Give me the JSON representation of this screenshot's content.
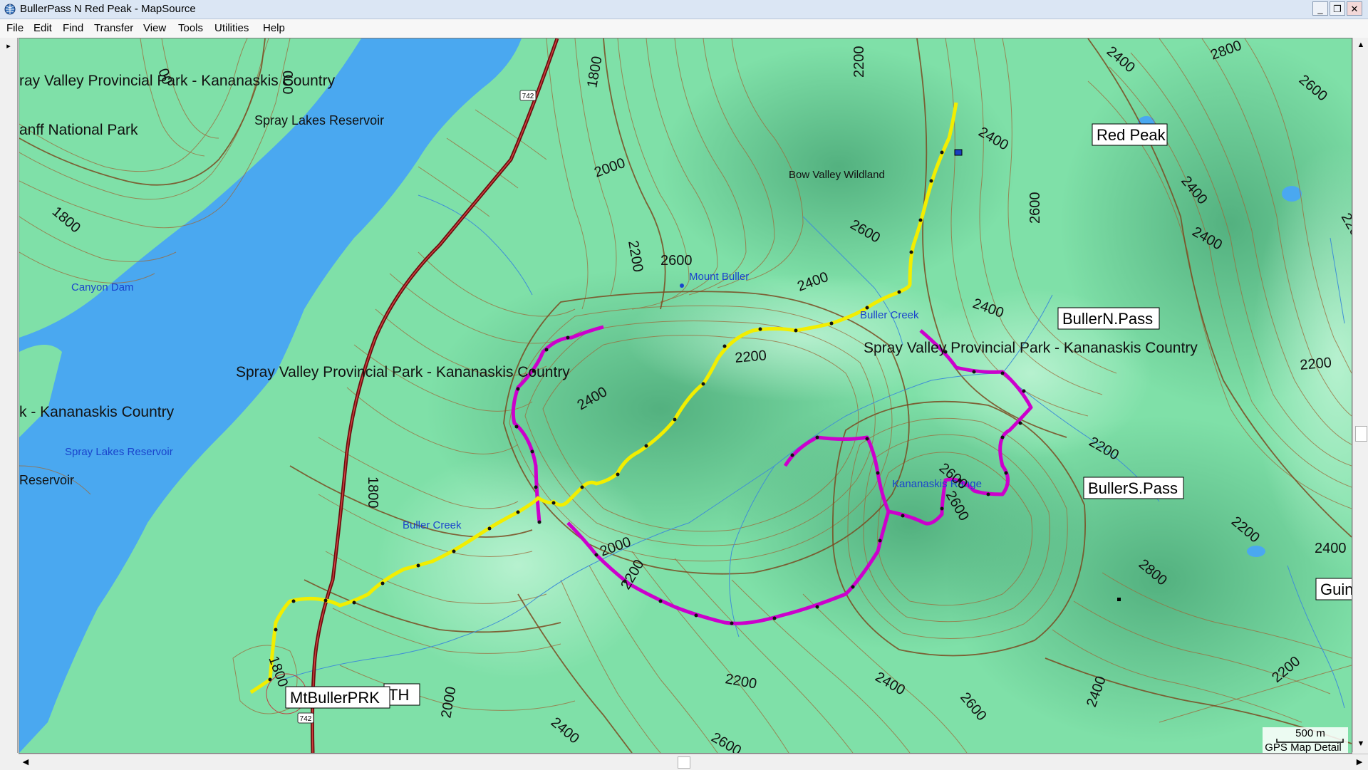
{
  "window": {
    "title": "BullerPass N Red Peak - MapSource"
  },
  "menu": [
    "File",
    "Edit",
    "Find",
    "Transfer",
    "View",
    "Tools",
    "Utilities",
    "Help"
  ],
  "window_buttons": {
    "minimize": "_",
    "restore": "❐",
    "close": "✕"
  },
  "map": {
    "area_labels": {
      "spray_valley_top": "ray Valley Provincial Park - Kananaskis Country",
      "banff": "anff National Park",
      "spray_lakes_reservoir_top": "Spray Lakes Reservoir",
      "spray_valley_center": "Spray Valley Provincial Park - Kananaskis Country",
      "spray_valley_right": "Spray Valley Provincial Park - Kananaskis Country",
      "kananaskis_country": "k - Kananaskis Country",
      "reservoir": "Reservoir"
    },
    "place_labels": {
      "canyon_dam": "Canyon Dam",
      "spray_lakes_reservoir_blue": "Spray Lakes Reservoir",
      "bow_valley_wildland": "Bow Valley Wildland",
      "mount_buller": "Mount Buller",
      "buller_creek_upper": "Buller Creek",
      "buller_creek_lower": "Buller Creek",
      "kananaskis_range": "Kananaskis Range"
    },
    "waypoints": {
      "red_peak": "Red Peak",
      "buller_n_pass": "BullerN.Pass",
      "buller_s_pass": "BullerS.Pass",
      "mt_buller_prk": "MtBullerPRK",
      "th": "TH",
      "guin": "Guin"
    },
    "road_shield": "742",
    "contour_labels": [
      "00",
      "000",
      "1800",
      "2200",
      "2400",
      "2800",
      "2600",
      "2000",
      "1800",
      "2200",
      "2600",
      "2400",
      "2600",
      "2400",
      "2200",
      "2400",
      "2400",
      "2200",
      "2200",
      "1800",
      "2000",
      "2200",
      "2600",
      "2400",
      "2400",
      "2200",
      "2800",
      "2400",
      "2200",
      "1800",
      "2000",
      "2400",
      "2600",
      "2200",
      "2400",
      "2600",
      "2400",
      "2200",
      "2600",
      "2400"
    ],
    "scale": {
      "distance": "500 m",
      "detail": "GPS Map Detail"
    }
  },
  "colors": {
    "terrain": "#7fe0a8",
    "water": "#4aa8f0",
    "track_yellow": "#f5f200",
    "track_magenta": "#d000d8",
    "contour": "#8a5a2a",
    "road": "#7a1010"
  }
}
